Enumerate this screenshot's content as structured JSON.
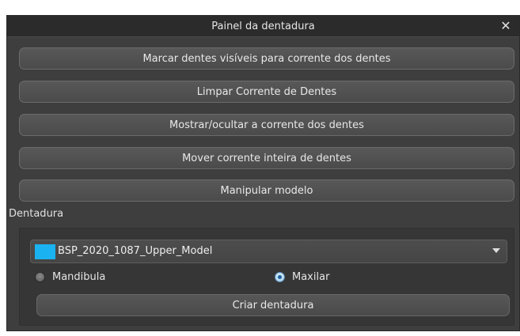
{
  "window": {
    "title": "Painel da dentadura",
    "close_glyph": "✕"
  },
  "actions": [
    {
      "label": "Marcar dentes visíveis para corrente dos dentes"
    },
    {
      "label": "Limpar Corrente de Dentes"
    },
    {
      "label": "Mostrar/ocultar a corrente dos dentes"
    },
    {
      "label": "Mover corrente inteira de dentes"
    },
    {
      "label": "Manipular modelo"
    }
  ],
  "denture": {
    "section_label": "Dentadura",
    "model_select": {
      "value": "BSP_2020_1087_Upper_Model",
      "swatch_color": "#1ab2f0"
    },
    "jaw_options": [
      {
        "label": "Mandibula",
        "checked": false
      },
      {
        "label": "Maxilar",
        "checked": true
      }
    ],
    "create_label": "Criar dentadura"
  }
}
